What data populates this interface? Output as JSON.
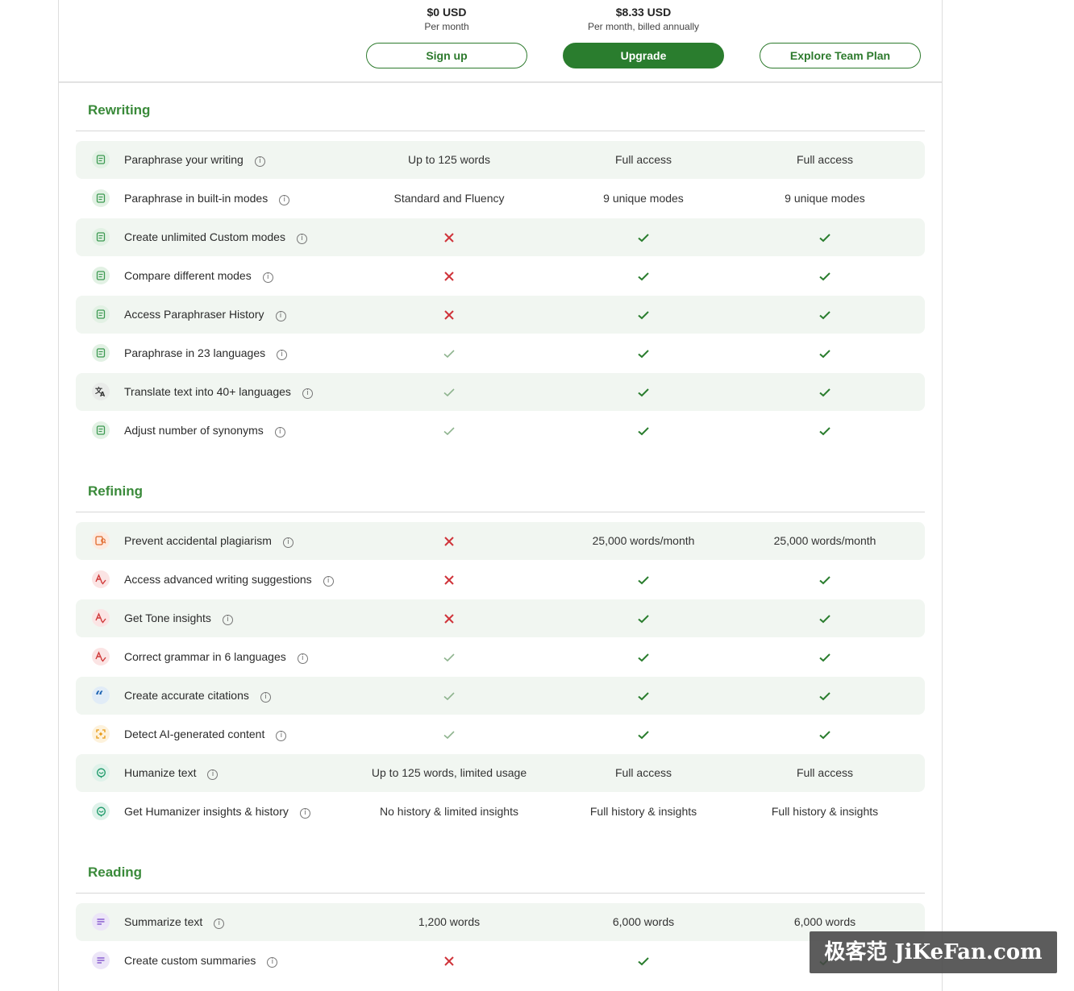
{
  "plans": [
    {
      "price": "$0 USD",
      "period": "Per month",
      "button": "Sign up",
      "primary": false
    },
    {
      "price": "$8.33 USD",
      "period": "Per month, billed annually",
      "button": "Upgrade",
      "primary": true
    },
    {
      "price": "",
      "period": "",
      "button": "Explore Team Plan",
      "primary": false
    }
  ],
  "sections": [
    {
      "title": "Rewriting",
      "rows": [
        {
          "icon": "paraphraser-icon",
          "label": "Paraphrase your writing",
          "free": "Up to 125 words",
          "premium": "Full access",
          "team": "Full access"
        },
        {
          "icon": "paraphraser-icon",
          "label": "Paraphrase in built-in modes",
          "free": "Standard and Fluency",
          "premium": "9 unique modes",
          "team": "9 unique modes"
        },
        {
          "icon": "paraphraser-icon",
          "label": "Create unlimited Custom modes",
          "free": "cross",
          "premium": "check",
          "team": "check"
        },
        {
          "icon": "paraphraser-icon",
          "label": "Compare different modes",
          "free": "cross",
          "premium": "check",
          "team": "check"
        },
        {
          "icon": "paraphraser-icon",
          "label": "Access Paraphraser History",
          "free": "cross",
          "premium": "check",
          "team": "check"
        },
        {
          "icon": "paraphraser-icon",
          "label": "Paraphrase in 23 languages",
          "free": "check-light",
          "premium": "check",
          "team": "check"
        },
        {
          "icon": "translate-icon",
          "label": "Translate text into 40+ languages",
          "free": "check-light",
          "premium": "check",
          "team": "check"
        },
        {
          "icon": "paraphraser-icon",
          "label": "Adjust number of synonyms",
          "free": "check-light",
          "premium": "check",
          "team": "check"
        }
      ]
    },
    {
      "title": "Refining",
      "rows": [
        {
          "icon": "plagiarism-icon",
          "label": "Prevent accidental plagiarism",
          "free": "cross",
          "premium": "25,000 words/month",
          "team": "25,000 words/month"
        },
        {
          "icon": "grammar-icon",
          "label": "Access advanced writing suggestions",
          "free": "cross",
          "premium": "check",
          "team": "check"
        },
        {
          "icon": "grammar-icon",
          "label": "Get Tone insights",
          "free": "cross",
          "premium": "check",
          "team": "check"
        },
        {
          "icon": "grammar-icon",
          "label": "Correct grammar in 6 languages",
          "free": "check-light",
          "premium": "check",
          "team": "check"
        },
        {
          "icon": "citation-icon",
          "label": "Create accurate citations",
          "free": "check-light",
          "premium": "check",
          "team": "check"
        },
        {
          "icon": "ai-detector-icon",
          "label": "Detect AI-generated content",
          "free": "check-light",
          "premium": "check",
          "team": "check"
        },
        {
          "icon": "humanizer-icon",
          "label": "Humanize text",
          "free": "Up to 125 words, limited usage",
          "premium": "Full access",
          "team": "Full access"
        },
        {
          "icon": "humanizer-icon",
          "label": "Get Humanizer insights & history",
          "free": "No history & limited insights",
          "premium": "Full history & insights",
          "team": "Full history & insights"
        }
      ]
    },
    {
      "title": "Reading",
      "rows": [
        {
          "icon": "summarizer-icon",
          "label": "Summarize text",
          "free": "1,200 words",
          "premium": "6,000 words",
          "team": "6,000 words"
        },
        {
          "icon": "summarizer-icon",
          "label": "Create custom summaries",
          "free": "cross",
          "premium": "check",
          "team": "check"
        }
      ]
    }
  ],
  "watermark": "极客范 JiKeFan.com",
  "colors": {
    "accent": "#2a7d2e",
    "check": "#2a7d2e",
    "check_light": "#8fb48f",
    "cross": "#d0343a",
    "row_shade": "#f1f6f1"
  }
}
